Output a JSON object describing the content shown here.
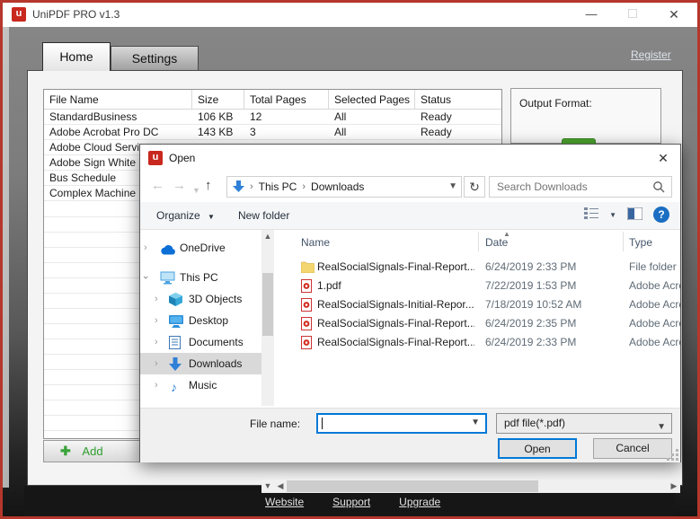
{
  "window": {
    "title": "UniPDF PRO v1.3",
    "tabs": [
      {
        "label": "Home",
        "active": true
      },
      {
        "label": "Settings",
        "active": false
      }
    ],
    "register_label": "Register",
    "table": {
      "columns": [
        "File Name",
        "Size",
        "Total Pages",
        "Selected Pages",
        "Status"
      ],
      "rows": [
        {
          "file_name": "StandardBusiness",
          "size": "106 KB",
          "total_pages": "12",
          "selected_pages": "All",
          "status": "Ready"
        },
        {
          "file_name": "Adobe Acrobat Pro DC",
          "size": "143 KB",
          "total_pages": "3",
          "selected_pages": "All",
          "status": "Ready"
        },
        {
          "file_name": "Adobe Cloud Servi",
          "size": "",
          "total_pages": "",
          "selected_pages": "",
          "status": ""
        },
        {
          "file_name": "Adobe Sign White",
          "size": "",
          "total_pages": "",
          "selected_pages": "",
          "status": ""
        },
        {
          "file_name": "Bus Schedule",
          "size": "",
          "total_pages": "",
          "selected_pages": "",
          "status": ""
        },
        {
          "file_name": "Complex Machine",
          "size": "",
          "total_pages": "",
          "selected_pages": "",
          "status": ""
        }
      ]
    },
    "output_format_label": "Output Format:",
    "add_button_label": "Add",
    "footer_links": [
      "Website",
      "Support",
      "Upgrade"
    ]
  },
  "dialog": {
    "title": "Open",
    "breadcrumb": [
      "This PC",
      "Downloads"
    ],
    "search_placeholder": "Search Downloads",
    "toolbar": {
      "organize_label": "Organize",
      "new_folder_label": "New folder"
    },
    "sidebar_items": [
      {
        "label": "OneDrive"
      },
      {
        "label": "This PC"
      },
      {
        "label": "3D Objects"
      },
      {
        "label": "Desktop"
      },
      {
        "label": "Documents"
      },
      {
        "label": "Downloads",
        "selected": true
      },
      {
        "label": "Music"
      }
    ],
    "list": {
      "columns": [
        "Name",
        "Date",
        "Type"
      ],
      "rows": [
        {
          "name": "RealSocialSignals-Final-Report...",
          "date": "6/24/2019 2:33 PM",
          "type": "File folder",
          "icon": "folder"
        },
        {
          "name": "1.pdf",
          "date": "7/22/2019 1:53 PM",
          "type": "Adobe Acro",
          "icon": "pdf"
        },
        {
          "name": "RealSocialSignals-Initial-Repor...",
          "date": "7/18/2019 10:52 AM",
          "type": "Adobe Acro",
          "icon": "pdf"
        },
        {
          "name": "RealSocialSignals-Final-Report...",
          "date": "6/24/2019 2:35 PM",
          "type": "Adobe Acro",
          "icon": "pdf"
        },
        {
          "name": "RealSocialSignals-Final-Report...",
          "date": "6/24/2019 2:33 PM",
          "type": "Adobe Acro",
          "icon": "pdf"
        }
      ]
    },
    "file_name_label": "File name:",
    "file_name_value": "",
    "file_type_value": "pdf file(*.pdf)",
    "open_label": "Open",
    "cancel_label": "Cancel"
  },
  "colors": {
    "window_border": "#b5372c",
    "brand_red": "#c8281e",
    "accent_blue": "#0078d7",
    "convert_green": "#4ca32f",
    "footer_bg": "#161616"
  }
}
